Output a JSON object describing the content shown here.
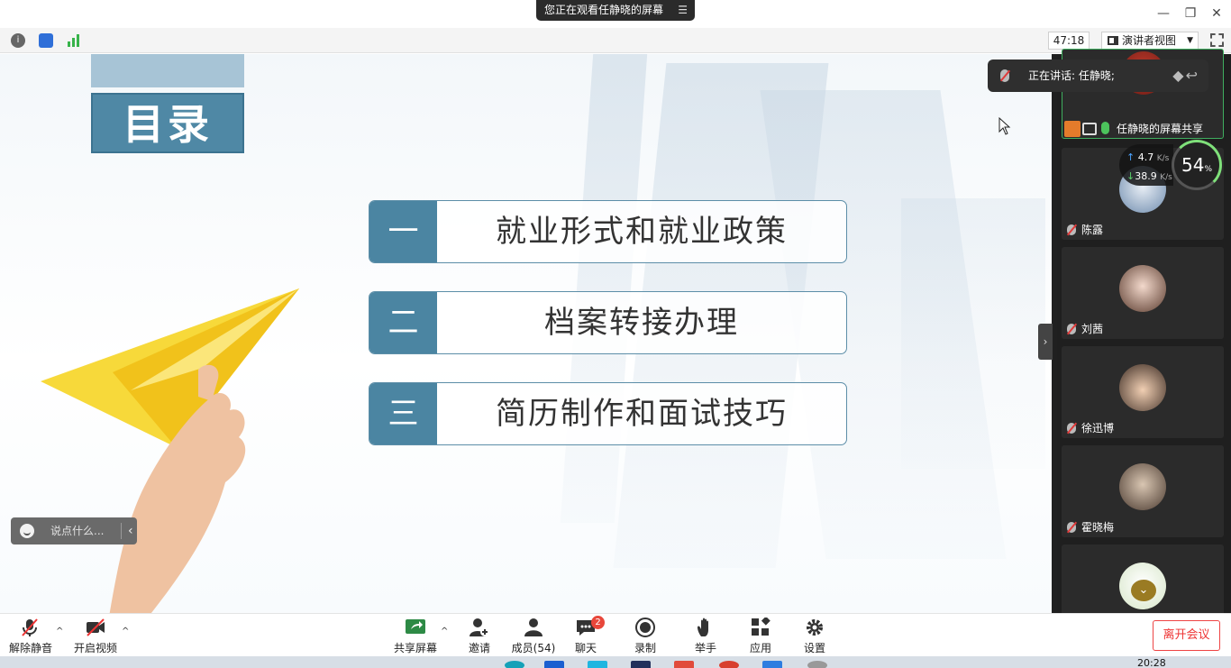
{
  "titlebar": {
    "viewing_text": "您正在观看任静晓的屏幕",
    "minimize": "—",
    "restore": "❐",
    "close": "✕"
  },
  "toolbar": {
    "info_icon": "i",
    "timer": "47:18",
    "view_mode": "演讲者视图"
  },
  "slide": {
    "title": "目录",
    "items": [
      {
        "num": "一",
        "text": "就业形式和就业政策"
      },
      {
        "num": "二",
        "text": "档案转接办理"
      },
      {
        "num": "三",
        "text": "简历制作和面试技巧"
      }
    ],
    "chat_placeholder": "说点什么..."
  },
  "sidepanel": {
    "speaking": "正在讲话: 任静晓;",
    "share_label": "任静晓的屏幕共享",
    "net_up": "4.7",
    "net_down": "38.9",
    "net_unit": "K/s",
    "cpu_value": "54",
    "cpu_unit": "%",
    "participants": [
      {
        "name": "陈露"
      },
      {
        "name": "刘茜"
      },
      {
        "name": "徐迅博"
      },
      {
        "name": "霍晓梅"
      }
    ]
  },
  "bottombar": {
    "unmute": "解除静音",
    "start_video": "开启视频",
    "share_screen": "共享屏幕",
    "invite": "邀请",
    "members": "成员(54)",
    "chat": "聊天",
    "chat_badge": "2",
    "record": "录制",
    "raise_hand": "举手",
    "apps": "应用",
    "settings": "设置",
    "leave": "离开会议"
  },
  "taskbar": {
    "clock": "20:28"
  },
  "colors": {
    "accent_blue": "#4b85a2",
    "active_green": "#3fae5f",
    "leave_red": "#e33333"
  }
}
